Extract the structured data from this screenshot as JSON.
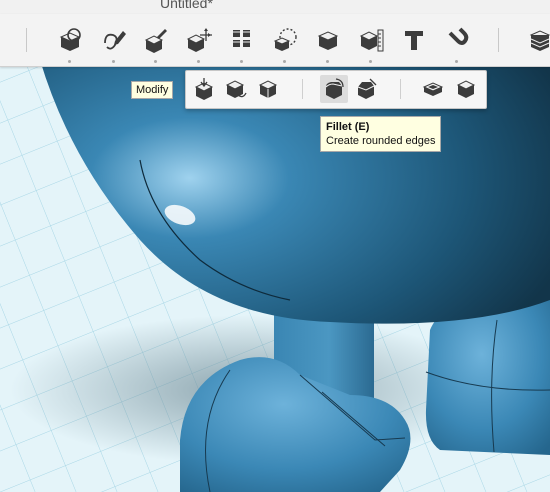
{
  "window": {
    "title": "Untitled*"
  },
  "toolbar": {
    "tools": [
      {
        "name": "sketch-tool",
        "icon": "sketch-icon"
      },
      {
        "name": "sketch-edit-tool",
        "icon": "pencil-curve-icon"
      },
      {
        "name": "construct-tool",
        "icon": "construct-icon"
      },
      {
        "name": "modify-tool",
        "icon": "modify-move-icon"
      },
      {
        "name": "pattern-tool",
        "icon": "pattern-grid-icon"
      },
      {
        "name": "grouping-tool",
        "icon": "grouping-icon"
      },
      {
        "name": "combine-tool",
        "icon": "combine-icon"
      },
      {
        "name": "measure-tool",
        "icon": "ruler-cube-icon"
      },
      {
        "name": "text-tool",
        "icon": "text-t-icon"
      },
      {
        "name": "snap-tool",
        "icon": "magnet-icon"
      },
      {
        "name": "material-tool",
        "icon": "stack-icon"
      }
    ]
  },
  "modify_menu": {
    "items": [
      {
        "name": "press-pull",
        "icon": "press-pull-icon"
      },
      {
        "name": "tweak",
        "icon": "tweak-icon"
      },
      {
        "name": "split-face",
        "icon": "split-icon"
      },
      {
        "name": "fillet",
        "icon": "fillet-icon",
        "active": true
      },
      {
        "name": "chamfer",
        "icon": "chamfer-icon"
      },
      {
        "name": "shell",
        "icon": "shell-icon"
      },
      {
        "name": "scale",
        "icon": "scale-icon"
      }
    ]
  },
  "tooltips": {
    "modify": "Modify",
    "fillet_title": "Fillet (E)",
    "fillet_desc": "Create rounded edges"
  },
  "colors": {
    "model_blue": "#3a87b4",
    "toolbar_bg": "#f3f3f3",
    "tooltip_bg": "#ffffe1",
    "grid_line": "#a9d7e6"
  }
}
